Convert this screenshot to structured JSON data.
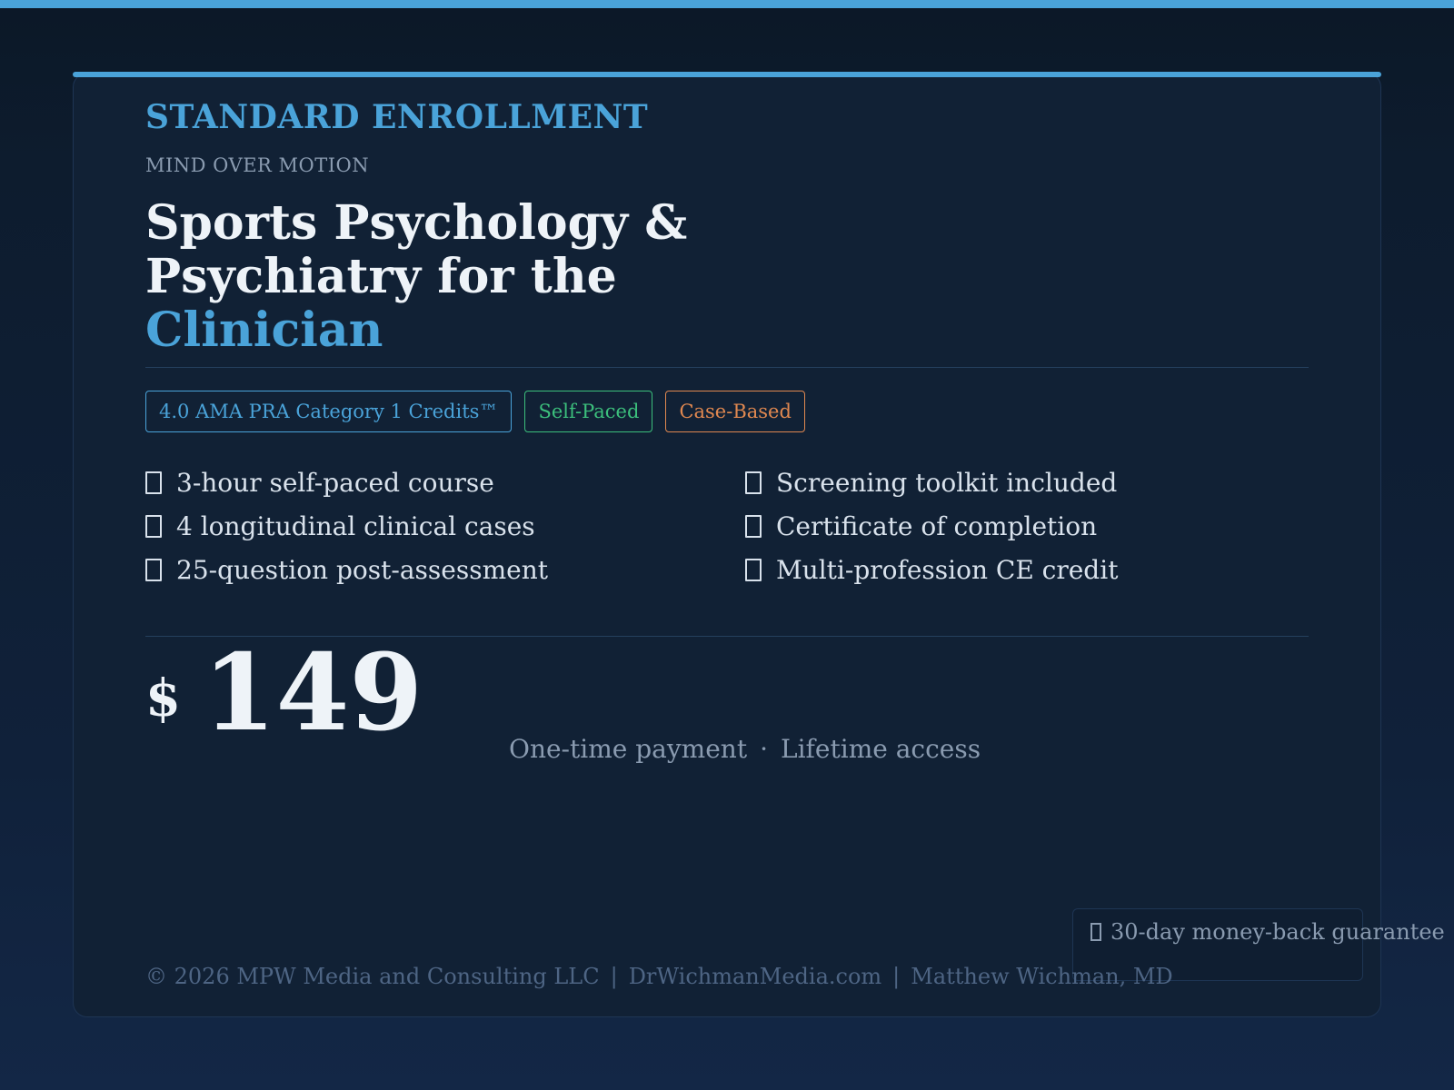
{
  "header": {
    "enrollment_label": "STANDARD ENROLLMENT",
    "brand": "MIND OVER MOTION",
    "title_line1": "Sports Psychology &",
    "title_line2": "Psychiatry for the",
    "title_accent": "Clinician"
  },
  "badges": [
    {
      "label": "4.0 AMA PRA Category 1 Credits™",
      "color": "#4aa3d9"
    },
    {
      "label": "Self-Paced",
      "color": "#3cbf7c"
    },
    {
      "label": "Case-Based",
      "color": "#e08850"
    }
  ],
  "features": [
    "3-hour self-paced course",
    "Screening toolkit included",
    "4 longitudinal clinical cases",
    "Certificate of completion",
    "25-question post-assessment",
    "Multi-profession CE credit"
  ],
  "price": {
    "currency": "$",
    "amount": "149",
    "payment_note": "One-time payment",
    "separator": "·",
    "access_note": "Lifetime access"
  },
  "guarantee": "30-day money-back guarantee",
  "footer": {
    "copyright": "© 2026 MPW Media and Consulting LLC",
    "separator": "|",
    "website": "DrWichmanMedia.com",
    "author": "Matthew Wichman, MD"
  },
  "colors": {
    "accent": "#4aa3d9",
    "background": "#0c1827",
    "card": "#112135"
  }
}
